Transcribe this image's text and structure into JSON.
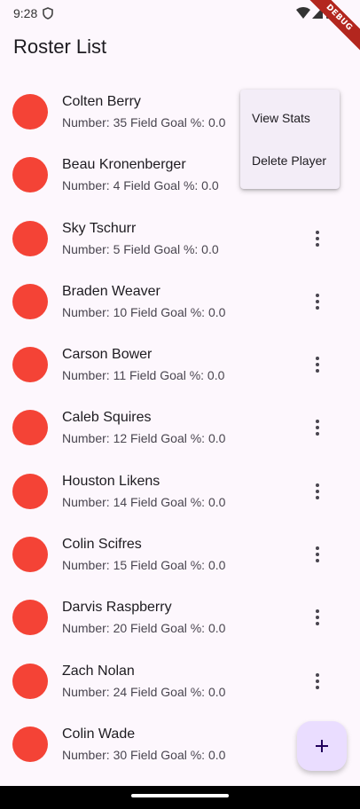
{
  "status_bar": {
    "time": "9:28",
    "debug_label": "DEBUG"
  },
  "app_bar": {
    "title": "Roster List"
  },
  "players": [
    {
      "name": "Colten Berry",
      "subtitle": "Number: 35 Field Goal %: 0.0"
    },
    {
      "name": "Beau Kronenberger",
      "subtitle": "Number: 4 Field Goal %: 0.0"
    },
    {
      "name": "Sky Tschurr",
      "subtitle": "Number: 5 Field Goal %: 0.0"
    },
    {
      "name": "Braden Weaver",
      "subtitle": "Number: 10 Field Goal %: 0.0"
    },
    {
      "name": "Carson Bower",
      "subtitle": "Number: 11 Field Goal %: 0.0"
    },
    {
      "name": "Caleb Squires",
      "subtitle": "Number: 12 Field Goal %: 0.0"
    },
    {
      "name": "Houston Likens",
      "subtitle": "Number: 14 Field Goal %: 0.0"
    },
    {
      "name": "Colin Scifres",
      "subtitle": "Number: 15 Field Goal %: 0.0"
    },
    {
      "name": "Darvis Raspberry",
      "subtitle": "Number: 20 Field Goal %: 0.0"
    },
    {
      "name": "Zach Nolan",
      "subtitle": "Number: 24 Field Goal %: 0.0"
    },
    {
      "name": "Colin Wade",
      "subtitle": "Number: 30 Field Goal %: 0.0"
    }
  ],
  "popup_menu": {
    "items": [
      "View Stats",
      "Delete Player"
    ]
  },
  "icons": {
    "avatar": "circle-avatar",
    "more": "more-vert-icon",
    "fab": "add-icon"
  },
  "colors": {
    "avatar": "#f44336",
    "background": "#fdf7fd",
    "fab": "#eaddff",
    "menu": "#f3edf7",
    "debug_banner": "#b3261e"
  }
}
